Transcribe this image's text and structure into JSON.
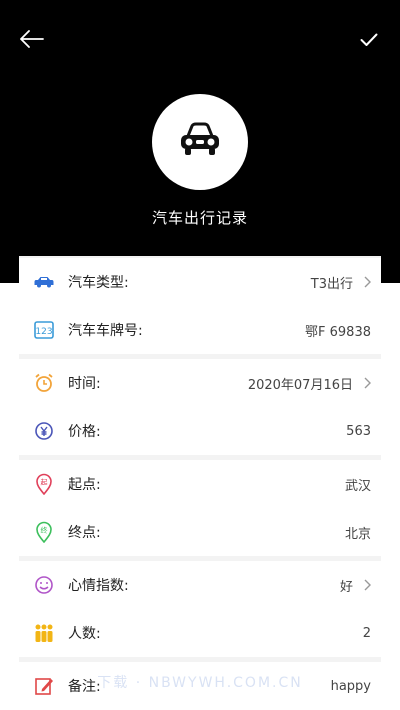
{
  "header": {
    "title": "汽车出行记录"
  },
  "rows": [
    {
      "label": "汽车类型:",
      "value": "T3出行",
      "chevron": true
    },
    {
      "label": "汽车车牌号:",
      "value": "鄂F 69838",
      "chevron": false
    },
    {
      "label": "时间:",
      "value": "2020年07月16日",
      "chevron": true
    },
    {
      "label": "价格:",
      "value": "563",
      "chevron": false
    },
    {
      "label": "起点:",
      "value": "武汉",
      "chevron": false
    },
    {
      "label": "终点:",
      "value": "北京",
      "chevron": false
    },
    {
      "label": "心情指数:",
      "value": "好",
      "chevron": true
    },
    {
      "label": "人数:",
      "value": "2",
      "chevron": false
    },
    {
      "label": "备注:",
      "value": "happy",
      "chevron": false
    }
  ],
  "watermark": "下载 · NBWYWH.COM.CN",
  "icons": {
    "back": "arrow-left-icon",
    "confirm": "check-icon",
    "avatar": "car-icon",
    "car_type": "car-small-icon",
    "plate": "number-123-icon",
    "time": "alarm-clock-icon",
    "price": "yen-coin-icon",
    "start": "start-pin-icon",
    "end": "end-pin-icon",
    "mood": "smiley-icon",
    "people": "people-icon",
    "note": "note-pen-icon"
  },
  "colors": {
    "header_bg": "#000000",
    "car_type_icon": "#2f6fd6",
    "plate_icon": "#3a9bd8",
    "time_icon": "#f2a43a",
    "price_icon": "#4a55b8",
    "start_icon": "#e0405a",
    "end_icon": "#3cbf5c",
    "mood_icon": "#b055c8",
    "people_icon": "#f2b515",
    "note_icon": "#e04848"
  }
}
